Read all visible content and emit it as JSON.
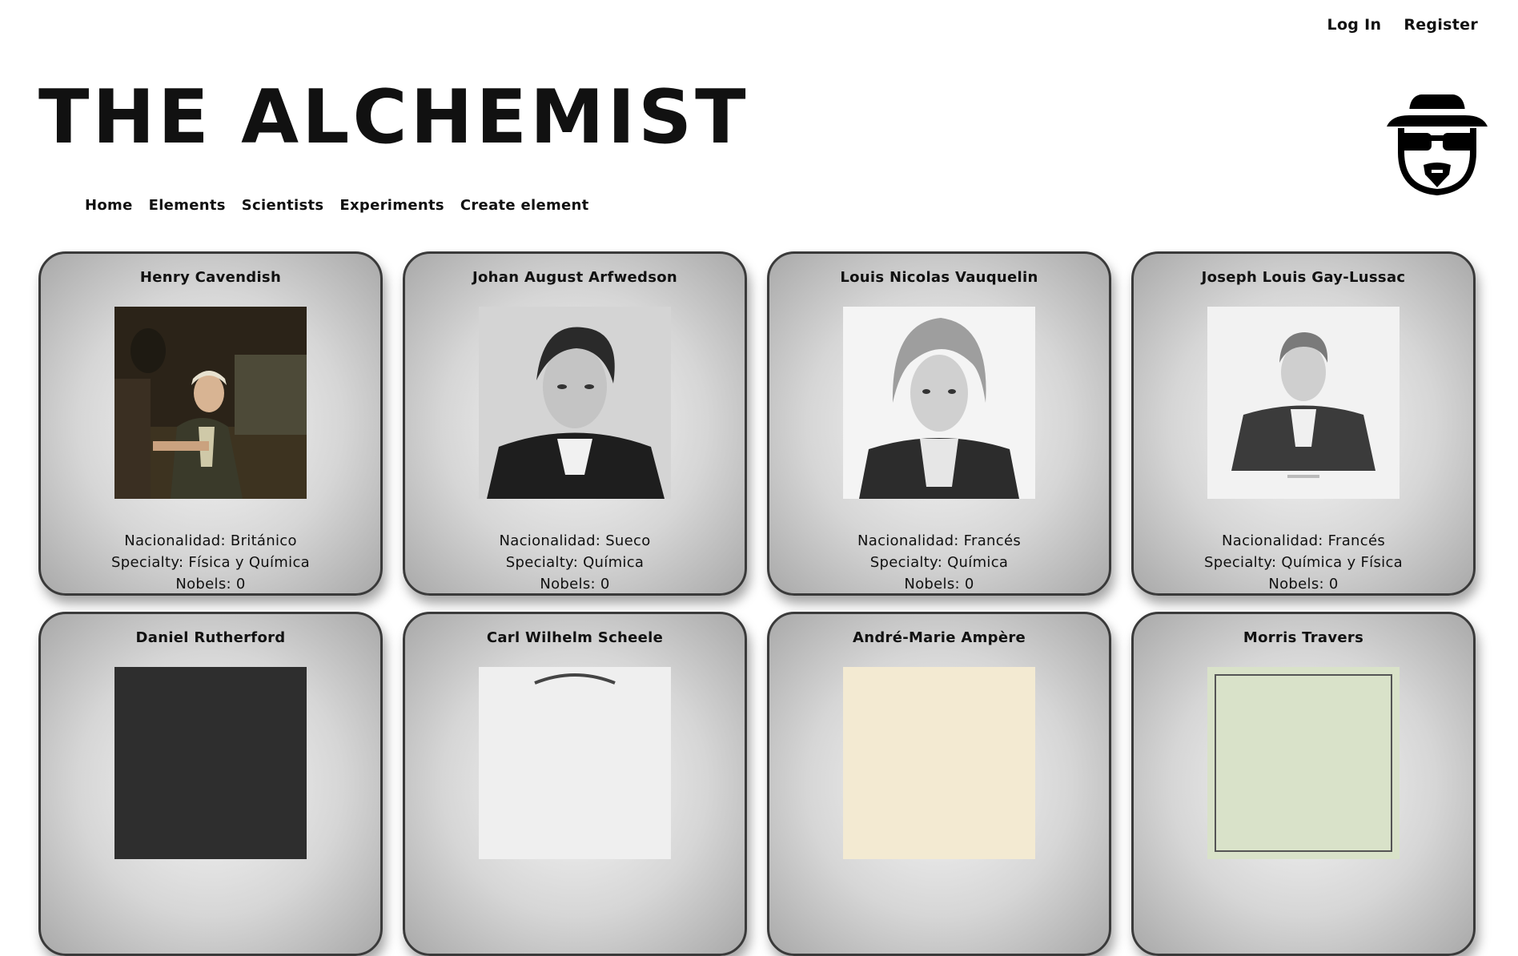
{
  "auth": {
    "login": "Log In",
    "register": "Register"
  },
  "site": {
    "title": "THE ALCHEMIST",
    "logo_icon": "heisenberg-icon"
  },
  "nav": [
    "Home",
    "Elements",
    "Scientists",
    "Experiments",
    "Create element"
  ],
  "scientists": [
    {
      "name": "Henry Cavendish",
      "nacionalidad": "Nacionalidad: Británico",
      "specialty": "Specialty: Física y Química",
      "nobels": "Nobels: 0",
      "portrait": "henry-cavendish-portrait"
    },
    {
      "name": "Johan August Arfwedson",
      "nacionalidad": "Nacionalidad: Sueco",
      "specialty": "Specialty: Química",
      "nobels": "Nobels: 0",
      "portrait": "arfwedson-portrait"
    },
    {
      "name": "Louis Nicolas Vauquelin",
      "nacionalidad": "Nacionalidad: Francés",
      "specialty": "Specialty: Química",
      "nobels": "Nobels: 0",
      "portrait": "vauquelin-portrait"
    },
    {
      "name": "Joseph Louis Gay-Lussac",
      "nacionalidad": "Nacionalidad: Francés",
      "specialty": "Specialty: Química y Física",
      "nobels": "Nobels: 0",
      "portrait": "gay-lussac-portrait"
    },
    {
      "name": "Daniel Rutherford",
      "portrait": "rutherford-portrait"
    },
    {
      "name": "Carl Wilhelm Scheele",
      "portrait": "scheele-portrait"
    },
    {
      "name": "André-Marie Ampère",
      "portrait": "ampere-portrait"
    },
    {
      "name": "Morris Travers",
      "portrait": "travers-portrait"
    }
  ]
}
